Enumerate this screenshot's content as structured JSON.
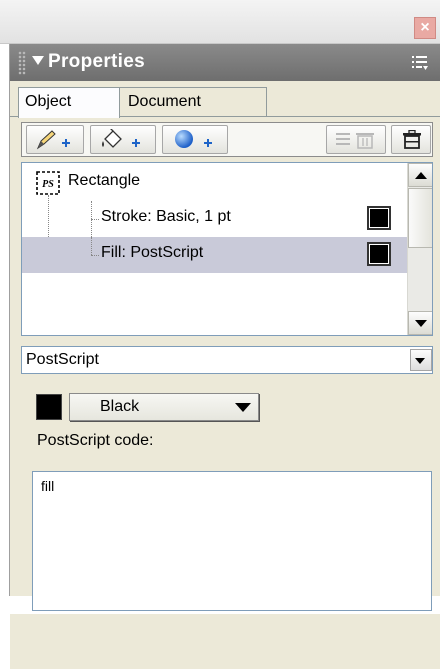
{
  "window": {
    "close_glyph": "×"
  },
  "panel": {
    "title": "Properties"
  },
  "tabs": [
    {
      "label": "Object",
      "selected": true
    },
    {
      "label": "Document",
      "selected": false
    }
  ],
  "toolbar": {
    "buttons": [
      {
        "name": "add-stroke-button",
        "icon": "pencil-plus-icon"
      },
      {
        "name": "add-fill-button",
        "icon": "paint-bucket-plus-icon"
      },
      {
        "name": "add-effect-button",
        "icon": "circle-plus-icon"
      },
      {
        "name": "delete-attribute-button",
        "icon": "list-trash-icon",
        "enabled": false
      },
      {
        "name": "delete-object-button",
        "icon": "trash-icon",
        "enabled": true
      }
    ]
  },
  "attributes": {
    "object": {
      "icon": "postscript-icon",
      "icon_text": "PS",
      "label": "Rectangle"
    },
    "items": [
      {
        "label": "Stroke: Basic, 1 pt",
        "swatch": "#000000",
        "selected": false
      },
      {
        "label": "Fill: PostScript",
        "swatch": "#000000",
        "selected": true
      }
    ]
  },
  "fill_type": {
    "value": "PostScript"
  },
  "color": {
    "swatch": "#000000",
    "value": "Black"
  },
  "code": {
    "label": "PostScript code:",
    "value": "fill"
  },
  "colors": {
    "panel_bg": "#ece9d8",
    "header": "#7c7c7c",
    "selection": "#c9cad9",
    "close": "#e9a9a3"
  }
}
